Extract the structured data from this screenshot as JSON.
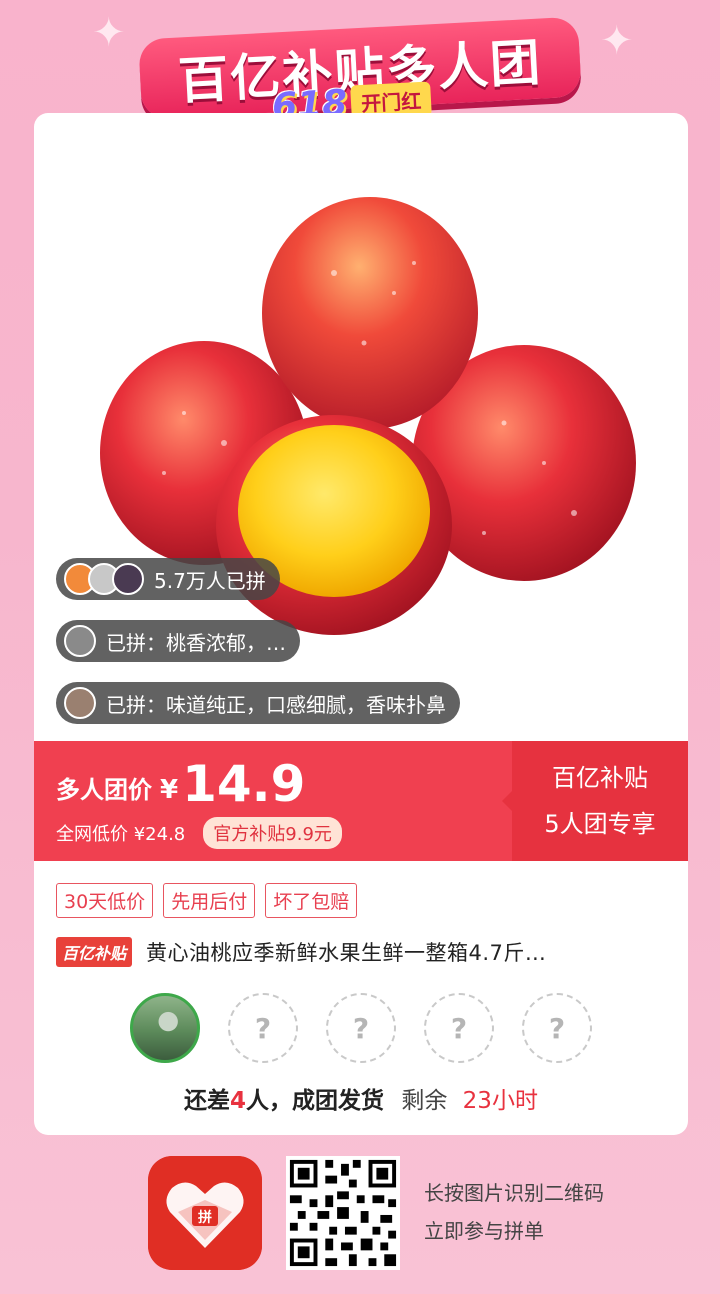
{
  "banner": {
    "title": "百亿补贴多人团",
    "badge_number": "618",
    "badge_text": "开门红"
  },
  "social": {
    "joined_count": "5.7万人已拼",
    "review_1": "已拼：桃香浓郁，…",
    "review_2": "已拼：味道纯正，口感细腻，香味扑鼻"
  },
  "price": {
    "label": "多人团价",
    "currency": "¥",
    "value": "14.9",
    "lowest_label": "全网低价 ¥24.8",
    "subsidy": "官方补贴9.9元",
    "right_line1": "百亿补贴",
    "right_line2": "5人团专享"
  },
  "tags": [
    "30天低价",
    "先用后付",
    "坏了包赔"
  ],
  "product": {
    "badge": "百亿补贴",
    "title": "黄心油桃应季新鲜水果生鲜一整箱4.7斤…"
  },
  "group": {
    "slots": [
      "filled",
      "?",
      "?",
      "?",
      "?"
    ],
    "status_prefix": "还差",
    "missing": "4",
    "status_suffix": "人，成团发货",
    "remaining_label": "剩余",
    "remaining_time": "23小时"
  },
  "footer": {
    "line1": "长按图片识别二维码",
    "line2": "立即参与拼单"
  },
  "colors": {
    "brand_red": "#f04050",
    "background_pink": "#f7b6cd"
  }
}
